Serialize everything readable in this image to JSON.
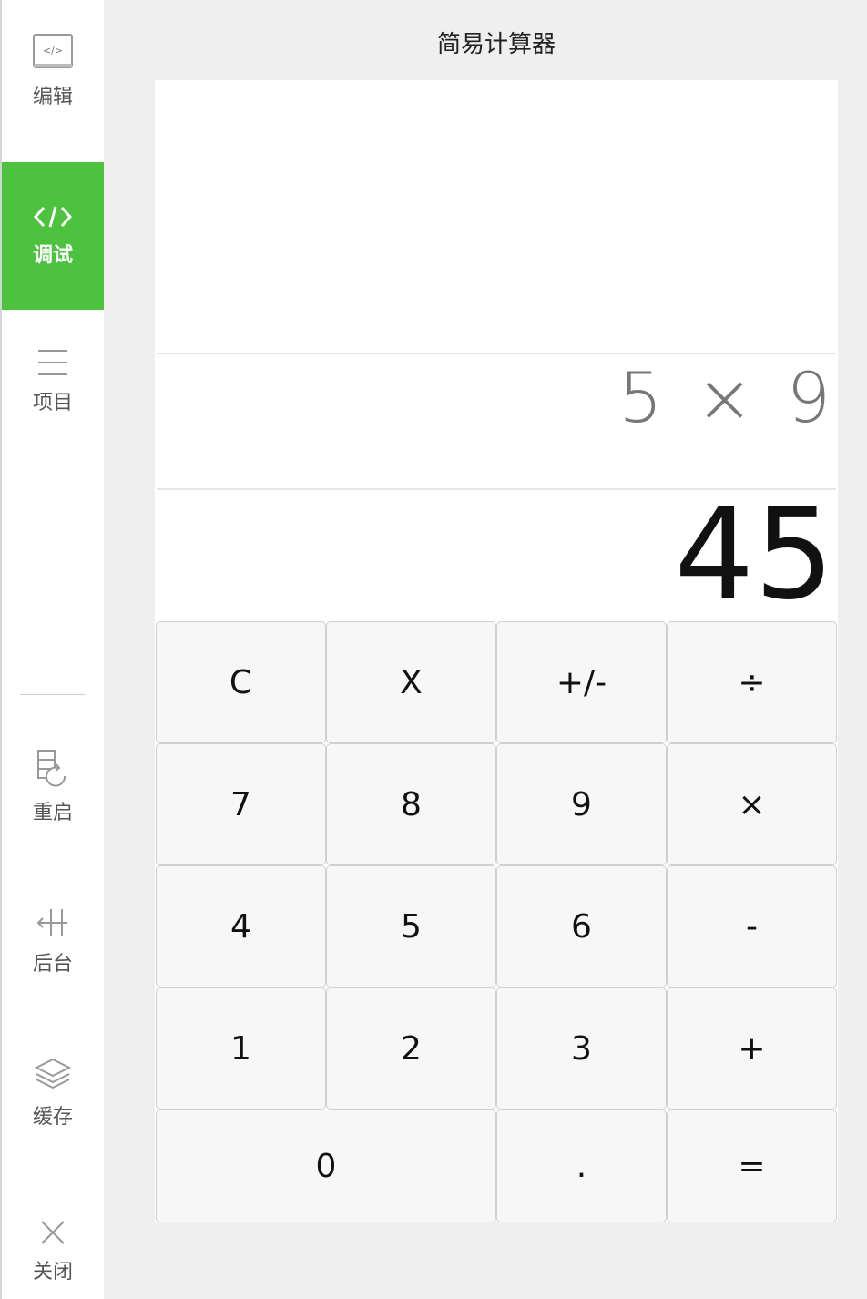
{
  "sidebar": {
    "edit_label": "编辑",
    "debug_label": "调试",
    "project_label": "项目",
    "restart_label": "重启",
    "background_label": "后台",
    "cache_label": "缓存",
    "close_label": "关闭"
  },
  "calculator": {
    "title": "简易计算器",
    "expression": "5 × 9",
    "result": "45",
    "keys": {
      "clear": "C",
      "backspace": "X",
      "sign": "+/-",
      "divide": "÷",
      "seven": "7",
      "eight": "8",
      "nine": "9",
      "multiply": "×",
      "four": "4",
      "five": "5",
      "six": "6",
      "minus": "-",
      "one": "1",
      "two": "2",
      "three": "3",
      "plus": "+",
      "zero": "0",
      "dot": ".",
      "equals": "="
    }
  },
  "colors": {
    "accent": "#4cc23f",
    "background": "#efefef"
  }
}
